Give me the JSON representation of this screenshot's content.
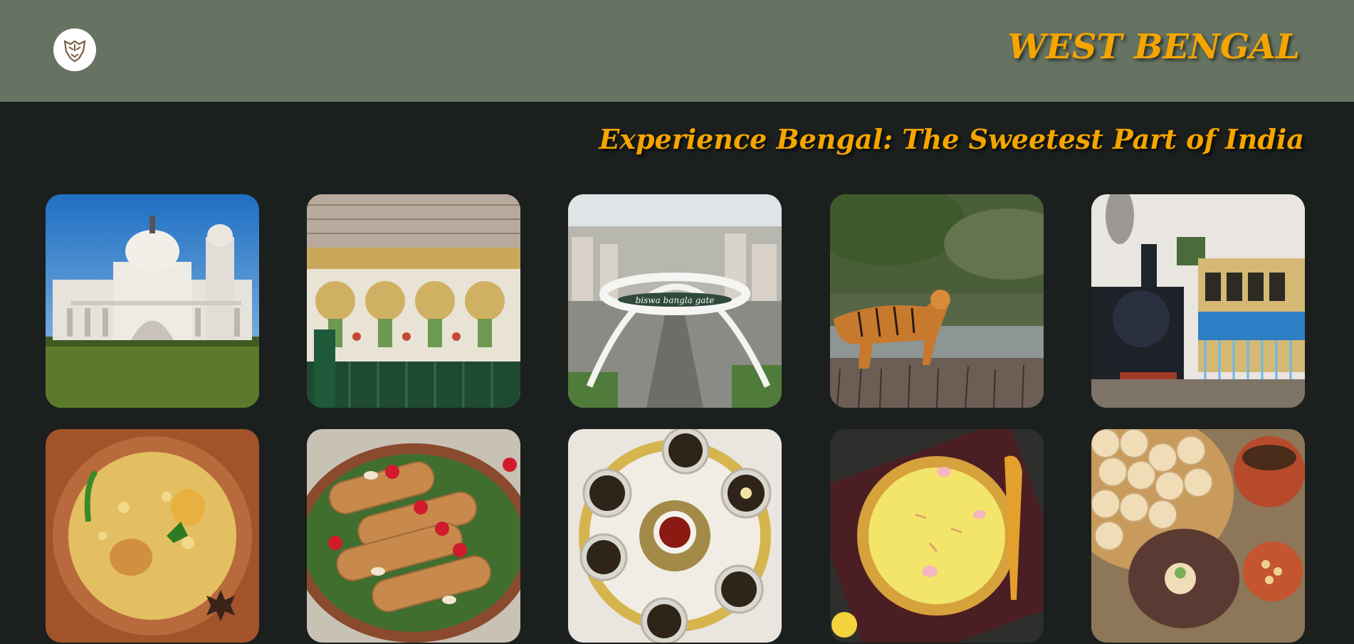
{
  "header": {
    "logo_icon": "tiger-face-logo",
    "title": "WEST BENGAL"
  },
  "hero": {
    "tagline": "Experience Bengal: The Sweetest Part of India"
  },
  "colors": {
    "header_bg": "#667362",
    "page_bg": "#1b1f1d",
    "accent": "#f5a500"
  },
  "gallery": {
    "row1": [
      "victoria-memorial",
      "heritage-stained-glass-pavilion",
      "biswa-bangla-gate",
      "royal-bengal-tiger",
      "darjeeling-toy-train"
    ],
    "row2": [
      "kolkata-biryani",
      "patishapta",
      "darjeeling-tea",
      "rasmalai",
      "puchka"
    ]
  },
  "gate_sign_text": "biswa bangla gate"
}
